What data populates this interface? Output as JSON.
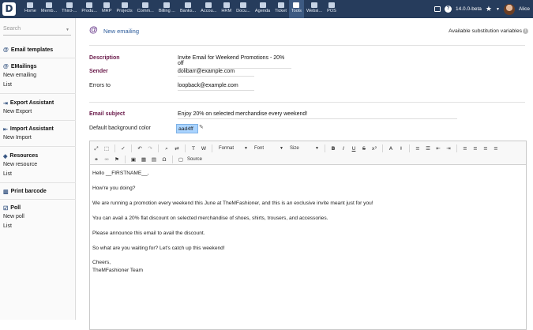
{
  "app": {
    "logo": "D",
    "version": "14.0.0-beta",
    "user": "Alice"
  },
  "menu": [
    {
      "label": "Home",
      "icon": "home-icon"
    },
    {
      "label": "Memb...",
      "icon": "members-icon"
    },
    {
      "label": "Third-...",
      "icon": "third-party-icon"
    },
    {
      "label": "Produ...",
      "icon": "products-icon"
    },
    {
      "label": "MRP",
      "icon": "mrp-icon"
    },
    {
      "label": "Projects",
      "icon": "projects-icon"
    },
    {
      "label": "Comm...",
      "icon": "commercial-icon"
    },
    {
      "label": "Billing ...",
      "icon": "billing-icon"
    },
    {
      "label": "Banks...",
      "icon": "bank-icon"
    },
    {
      "label": "Accou...",
      "icon": "accounting-icon"
    },
    {
      "label": "HRM",
      "icon": "hrm-icon"
    },
    {
      "label": "Docu...",
      "icon": "documents-icon"
    },
    {
      "label": "Agenda",
      "icon": "agenda-icon"
    },
    {
      "label": "Ticket",
      "icon": "ticket-icon"
    },
    {
      "label": "Tools",
      "icon": "tools-icon"
    },
    {
      "label": "Websi...",
      "icon": "website-icon"
    },
    {
      "label": "POS",
      "icon": "pos-icon"
    }
  ],
  "sidebar": {
    "search_placeholder": "Search",
    "sections": [
      {
        "title": "Email templates",
        "icon": "at-icon",
        "links": []
      },
      {
        "title": "EMailings",
        "icon": "at-icon",
        "links": [
          "New emailing",
          "List"
        ]
      },
      {
        "title": "Export Assistant",
        "icon": "export-icon",
        "links": [
          "New Export"
        ]
      },
      {
        "title": "Import Assistant",
        "icon": "import-icon",
        "links": [
          "New Import"
        ]
      },
      {
        "title": "Resources",
        "icon": "resource-icon",
        "links": [
          "New resource",
          "List"
        ]
      },
      {
        "title": "Print barcode",
        "icon": "barcode-icon",
        "links": []
      },
      {
        "title": "Poll",
        "icon": "poll-icon",
        "links": [
          "New poll",
          "List"
        ]
      }
    ]
  },
  "page": {
    "title": "New emailing",
    "substitution_link": "Available substitution variables"
  },
  "form": {
    "description_label": "Description",
    "description_value": "Invite Email for Weekend Promotions - 20% off",
    "sender_label": "Sender",
    "sender_value": "dolibarr@example.com",
    "errors_label": "Errors to",
    "errors_value": "loopback@example.com",
    "subject_label": "Email subject",
    "subject_value": "Enjoy 20% on selected merchandise every weekend!",
    "bgcolor_label": "Default background color",
    "bgcolor_value": "aad4ff"
  },
  "editor": {
    "format_label": "Format",
    "font_label": "Font",
    "size_label": "Size",
    "source_label": "Source",
    "body": [
      "Hello __FIRSTNAME__,",
      "How're you doing?",
      "We are running a promotion every weekend this June at TheMFashioner, and this is an exclusive invite meant just for you!",
      "You can avail a 20% flat discount on selected merchandise of shoes, shirts, trousers, and accessories.",
      "Please announce this email to avail the discount.",
      "So what are you waiting for? Let's catch up this weekend!",
      "Cheers,",
      "TheMFashioner Team"
    ]
  },
  "colors": {
    "topbar": "#263c5c",
    "accent": "#6a1a4a",
    "bg_swatch": "#aad4ff"
  }
}
